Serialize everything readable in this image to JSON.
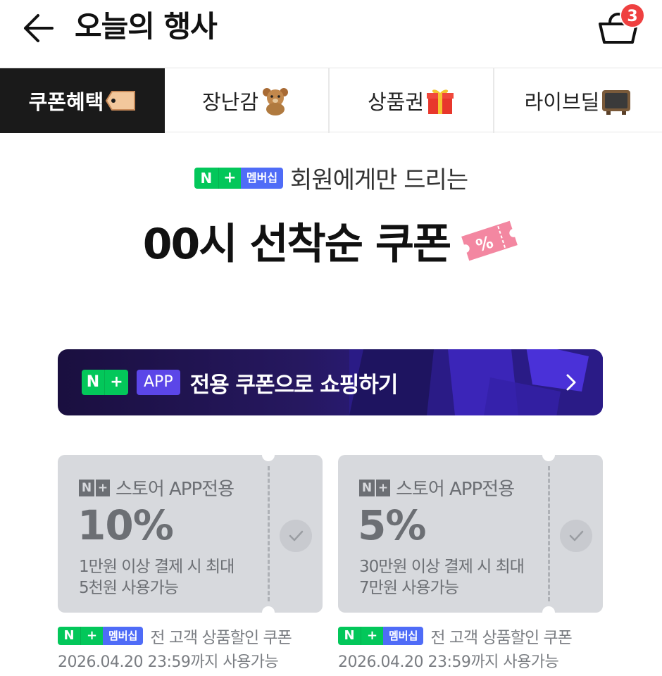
{
  "header": {
    "title": "오늘의 행사",
    "cart_count": "3"
  },
  "tabs": [
    {
      "label": "쿠폰혜택",
      "icon": "tag-icon",
      "active": true
    },
    {
      "label": "장난감",
      "icon": "teddy-bear-icon",
      "active": false
    },
    {
      "label": "상품권",
      "icon": "gift-icon",
      "active": false
    },
    {
      "label": "라이브딜",
      "icon": "tv-icon",
      "active": false
    }
  ],
  "hero": {
    "badge_n": "N",
    "badge_plus": "+",
    "badge_membership": "멤버십",
    "subtitle": "회원에게만 드리는",
    "title": "00시 선착순 쿠폰",
    "ticket_text": "%"
  },
  "banner": {
    "badge_n": "N",
    "badge_plus": "+",
    "badge_app": "APP",
    "text": "전용 쿠폰으로 쇼핑하기"
  },
  "coupons": [
    {
      "badge": "N+",
      "label": "스토어 APP전용",
      "value": "10%",
      "desc_line1": "1만원 이상 결제 시 최대",
      "desc_line2": "5천원 사용가능",
      "footer_badge_membership": "멤버십",
      "footer_text": "전 고객 상품할인 쿠폰",
      "footer_expiry": "2026.04.20 23:59까지 사용가능"
    },
    {
      "badge": "N+",
      "label": "스토어 APP전용",
      "value": "5%",
      "desc_line1": "30만원 이상 결제 시 최대",
      "desc_line2": "7만원 사용가능",
      "footer_badge_membership": "멤버십",
      "footer_text": "전 고객 상품할인 쿠폰",
      "footer_expiry": "2026.04.20 23:59까지 사용가능"
    }
  ],
  "colors": {
    "naver_green": "#03c75a",
    "membership_blue": "#4f6cf7",
    "badge_red": "#ef4040",
    "coupon_gray": "#d7d9dd",
    "active_tab": "#1a1a1a"
  }
}
